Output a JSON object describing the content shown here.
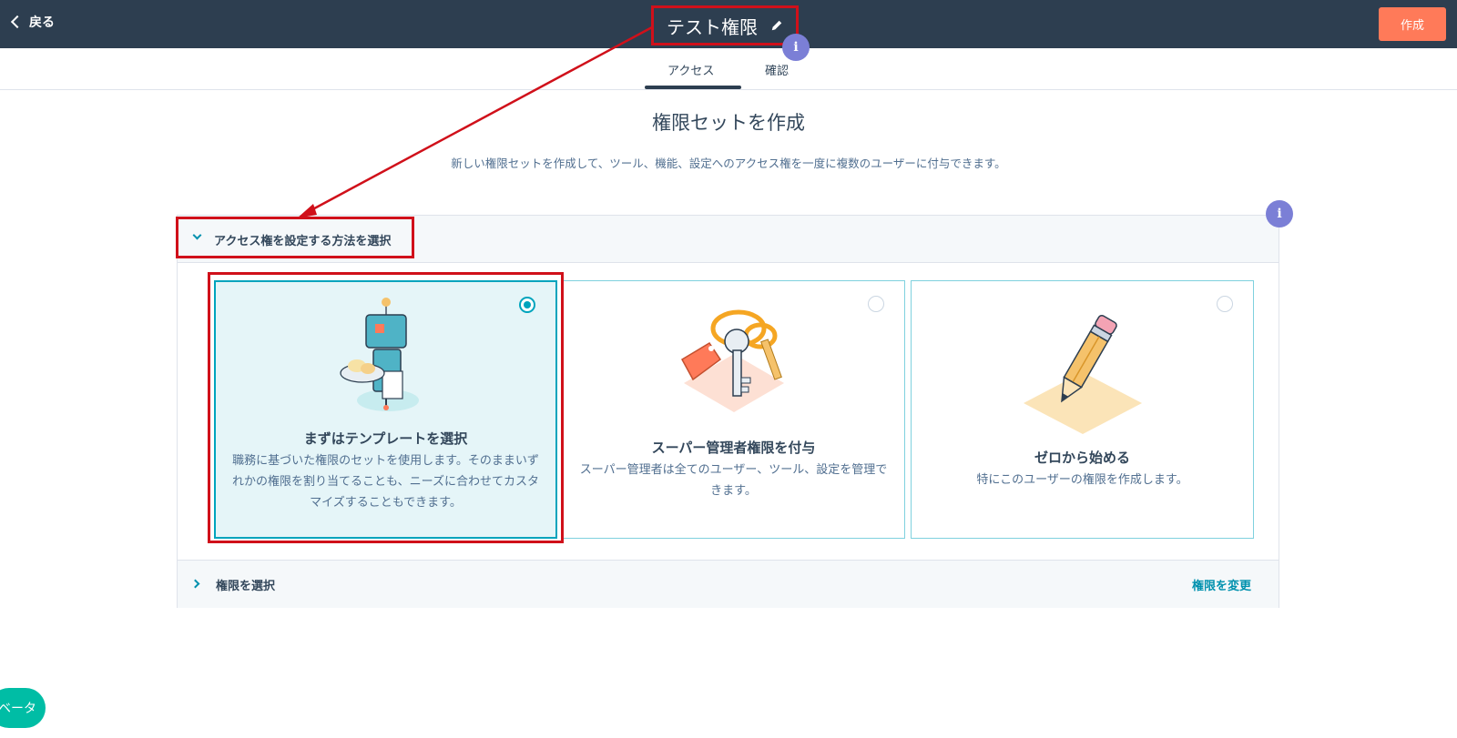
{
  "header": {
    "back_label": "戻る",
    "title": "テスト権限",
    "create_label": "作成",
    "info_label": "i"
  },
  "tabs": [
    {
      "label": "アクセス",
      "active": true
    },
    {
      "label": "確認",
      "active": false
    }
  ],
  "main": {
    "heading": "権限セットを作成",
    "subheading": "新しい権限セットを作成して、ツール、機能、設定へのアクセス権を一度に複数のユーザーに付与できます。"
  },
  "panel": {
    "section_title": "アクセス権を設定する方法を選択",
    "info_label": "i",
    "options": [
      {
        "title": "まずはテンプレートを選択",
        "description": "職務に基づいた権限のセットを使用します。そのままいずれかの権限を割り当てることも、ニーズに合わせてカスタマイズすることもできます。",
        "selected": true,
        "icon": "robot-waiter-icon"
      },
      {
        "title": "スーパー管理者権限を付与",
        "description": "スーパー管理者は全てのユーザー、ツール、設定を管理できます。",
        "selected": false,
        "icon": "keys-icon"
      },
      {
        "title": "ゼロから始める",
        "description": "特にこのユーザーの権限を作成します。",
        "selected": false,
        "icon": "pencil-icon"
      }
    ],
    "footer_title": "権限を選択",
    "footer_link": "権限を変更"
  },
  "beta_label": "ベータ",
  "colors": {
    "header_bg": "#2d3e50",
    "accent": "#ff7a59",
    "teal": "#00a4bd",
    "annotation_red": "#d0101a",
    "info_badge": "#7b7fd6"
  }
}
